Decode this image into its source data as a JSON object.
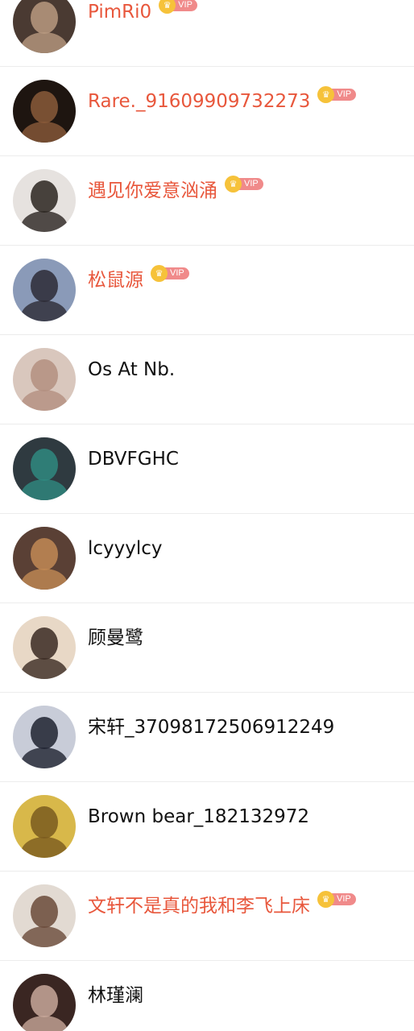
{
  "vip_label": "VIP",
  "users": [
    {
      "name": "PimRi0",
      "vip": true,
      "avatar_bg": "#4a3a32",
      "avatar_fg": "#b89a80"
    },
    {
      "name": "Rare._91609909732273",
      "vip": true,
      "avatar_bg": "#1e1510",
      "avatar_fg": "#8a5a3a"
    },
    {
      "name": "遇见你爱意汹涌",
      "vip": true,
      "avatar_bg": "#e6e2df",
      "avatar_fg": "#2a2420"
    },
    {
      "name": "松鼠源",
      "vip": true,
      "avatar_bg": "#8a9ab8",
      "avatar_fg": "#2c2a35"
    },
    {
      "name": "Os At Nb.",
      "vip": false,
      "avatar_bg": "#d9c7bd",
      "avatar_fg": "#b38f80"
    },
    {
      "name": "DBVFGHC",
      "vip": false,
      "avatar_bg": "#2f3a40",
      "avatar_fg": "#2f8a80"
    },
    {
      "name": "lcyyylcy",
      "vip": false,
      "avatar_bg": "#5a4035",
      "avatar_fg": "#c28a55"
    },
    {
      "name": "顾曼鹭",
      "vip": false,
      "avatar_bg": "#e8d8c6",
      "avatar_fg": "#3a2a22"
    },
    {
      "name": "宋轩_37098172506912249",
      "vip": false,
      "avatar_bg": "#c8ccd8",
      "avatar_fg": "#1e2230"
    },
    {
      "name": "Brown bear_182132972",
      "vip": false,
      "avatar_bg": "#d8b84a",
      "avatar_fg": "#7a5a1e"
    },
    {
      "name": "文轩不是真的我和李飞上床",
      "vip": true,
      "avatar_bg": "#e2dad2",
      "avatar_fg": "#6a4a3a"
    },
    {
      "name": "林瑾澜",
      "vip": false,
      "avatar_bg": "#3a2622",
      "avatar_fg": "#c8a89a"
    }
  ]
}
